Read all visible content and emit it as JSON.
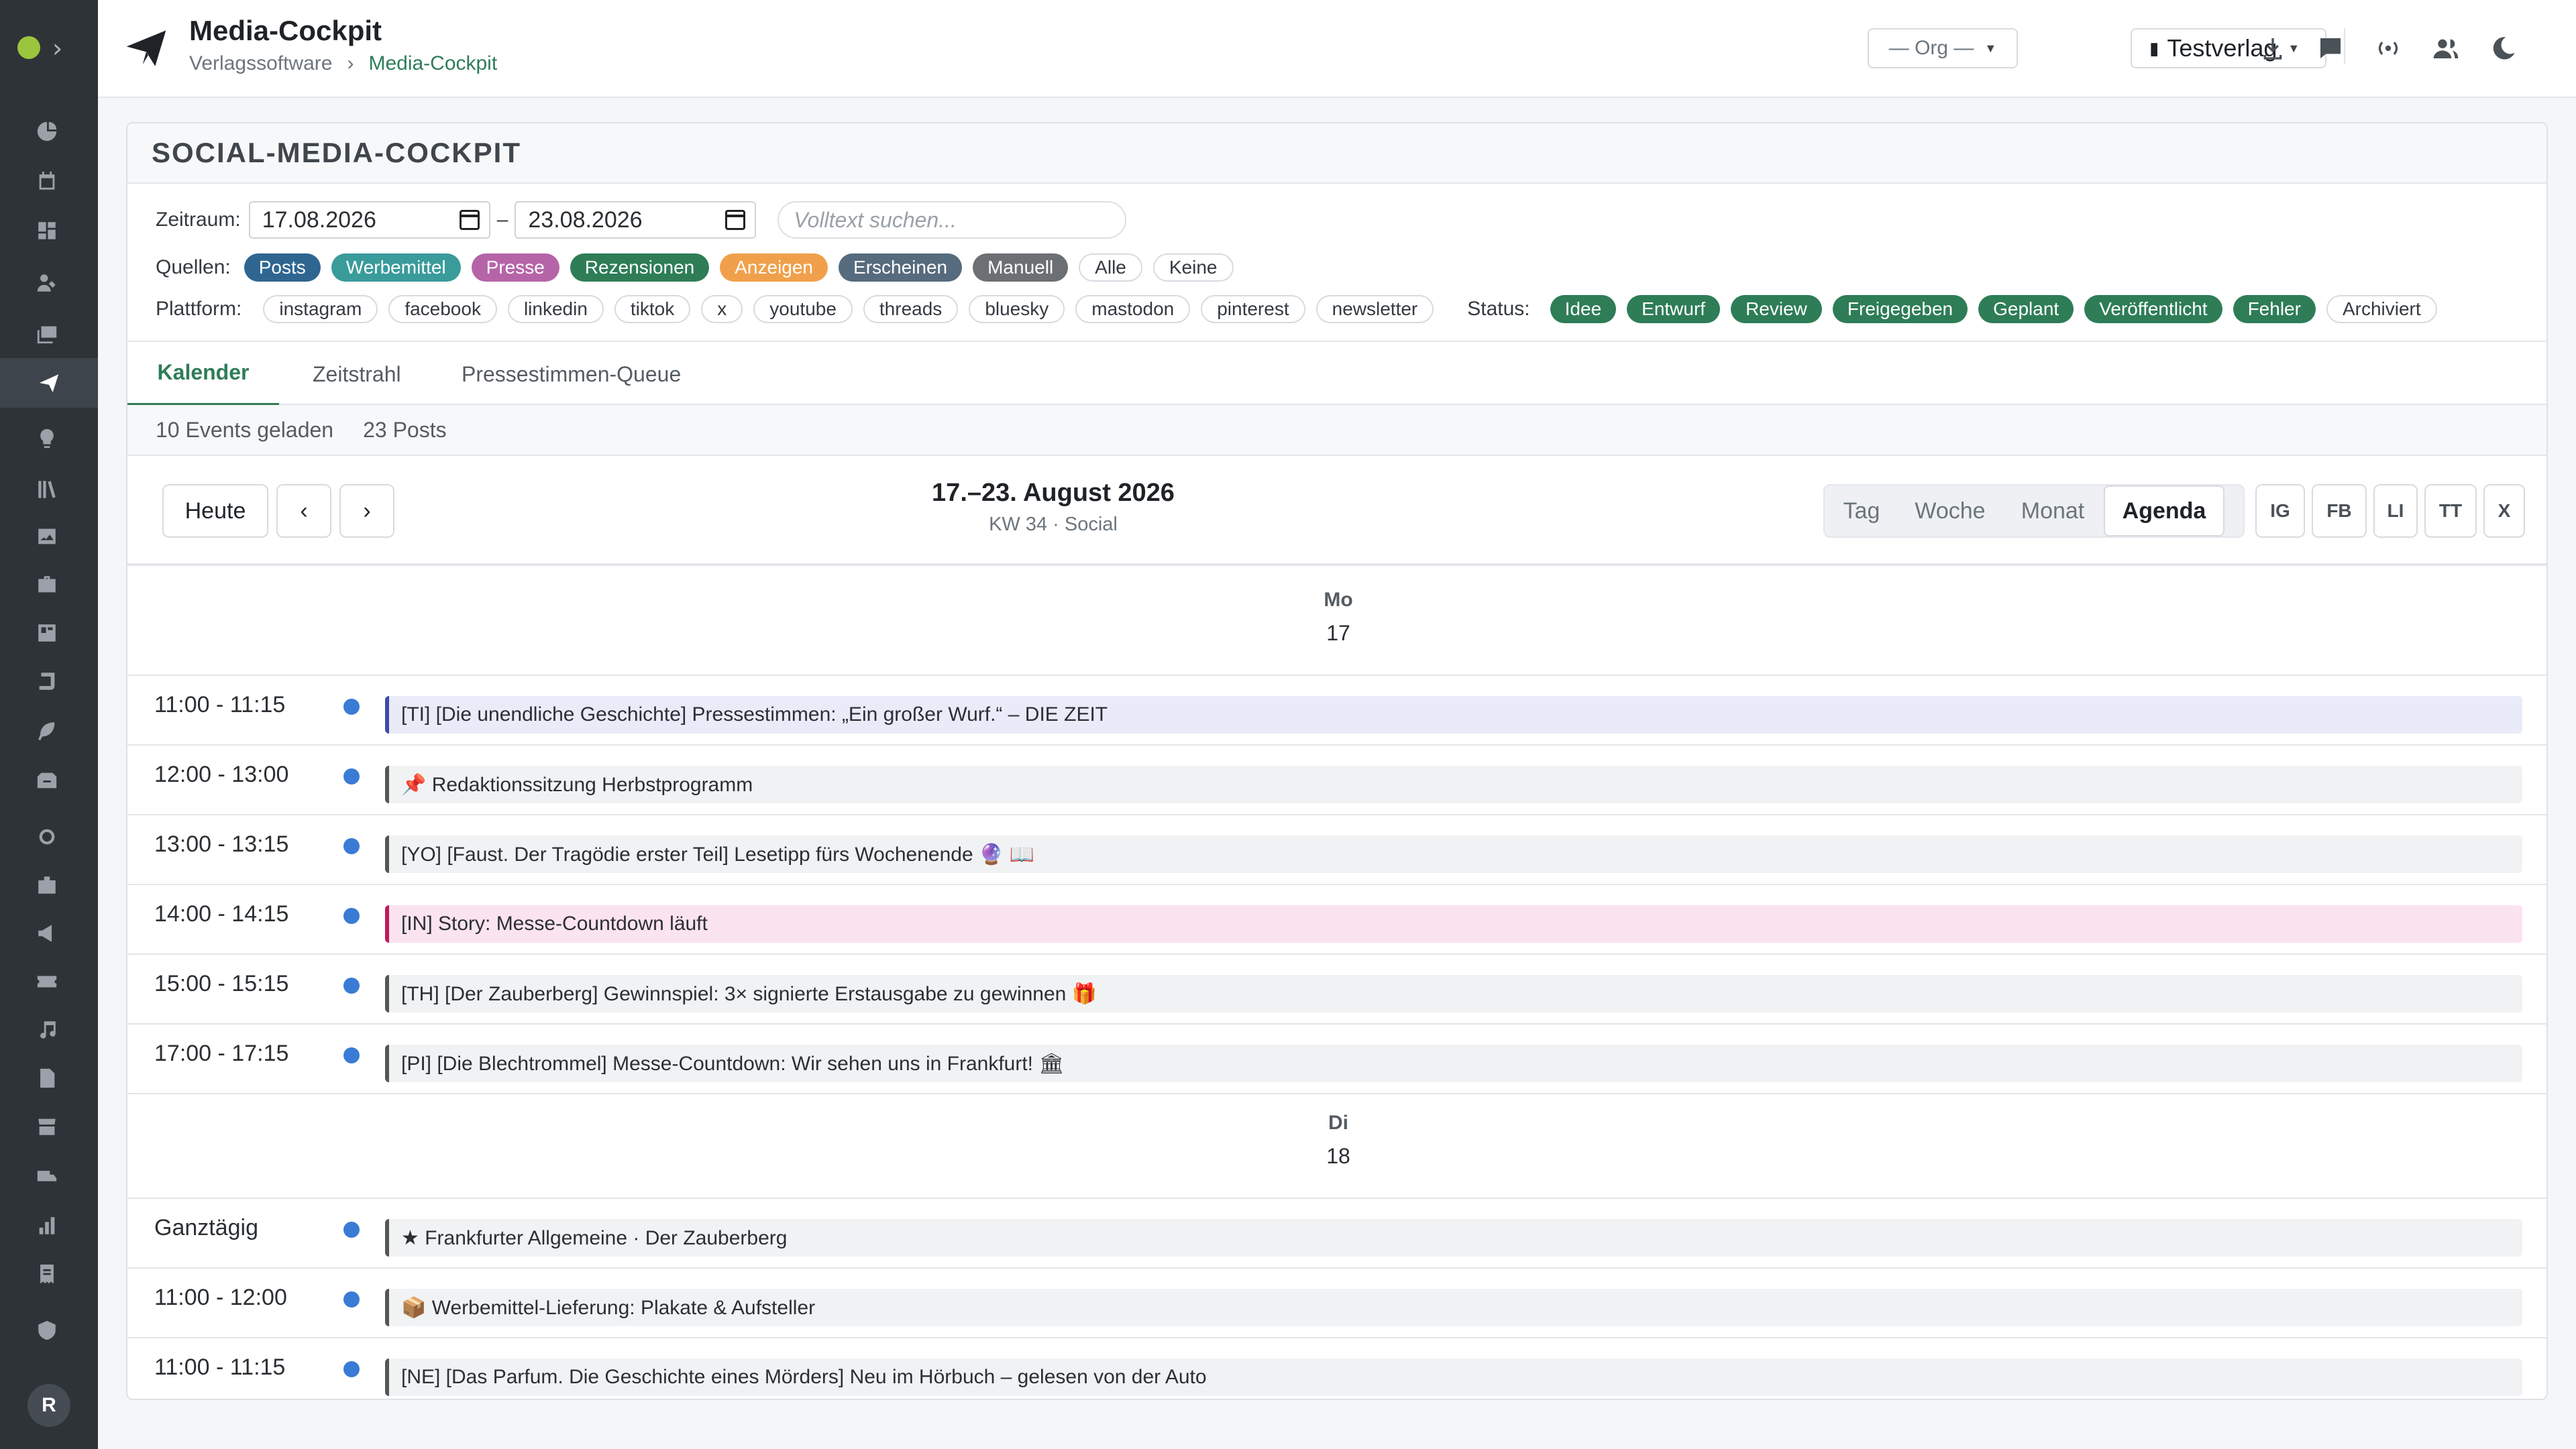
{
  "app": {
    "title": "Media-Cockpit",
    "breadcrumb": [
      "Verlagssoftware",
      "Media-Cockpit"
    ],
    "breadcrumb_sep": "›",
    "avatar": "R"
  },
  "topbar": {
    "org_label": "— Org —",
    "verlag_label": "Testverlag",
    "icons": [
      "download-icon",
      "chat-icon",
      "broadcast-icon",
      "users-icon",
      "moon-icon"
    ]
  },
  "card": {
    "title": "SOCIAL-MEDIA-COCKPIT"
  },
  "filters": {
    "zeitraum_label": "Zeitraum:",
    "date_from": "17.08.2026",
    "date_sep": "–",
    "date_to": "23.08.2026",
    "search_placeholder": "Volltext suchen...",
    "quellen_label": "Quellen:",
    "quellen": [
      {
        "label": "Posts",
        "color": "#2f6690"
      },
      {
        "label": "Werbemittel",
        "color": "#3a9b9b"
      },
      {
        "label": "Presse",
        "color": "#b564a8"
      },
      {
        "label": "Rezensionen",
        "color": "#2e7d57"
      },
      {
        "label": "Anzeigen",
        "color": "#f0a04b"
      },
      {
        "label": "Erscheinen",
        "color": "#566b7d"
      },
      {
        "label": "Manuell",
        "color": "#6c6f73"
      }
    ],
    "quellen_all": "Alle",
    "quellen_none": "Keine",
    "plattform_label": "Plattform:",
    "plattformen": [
      "instagram",
      "facebook",
      "linkedin",
      "tiktok",
      "x",
      "youtube",
      "threads",
      "bluesky",
      "mastodon",
      "pinterest",
      "newsletter"
    ],
    "status_label": "Status:",
    "status": [
      "Idee",
      "Entwurf",
      "Review",
      "Freigegeben",
      "Geplant",
      "Veröffentlicht",
      "Fehler"
    ],
    "status_extra": "Archiviert"
  },
  "tabs": [
    "Kalender",
    "Zeitstrahl",
    "Pressestimmen-Queue"
  ],
  "stats": {
    "events": "10 Events geladen",
    "posts": "23 Posts"
  },
  "calendar": {
    "today": "Heute",
    "prev": "‹",
    "next": "›",
    "title": "17.–23. August 2026",
    "subtitle": "KW 34 · Social",
    "views": [
      "Tag",
      "Woche",
      "Monat",
      "Agenda"
    ],
    "platform_buttons": [
      "IG",
      "FB",
      "LI",
      "TT",
      "X"
    ]
  },
  "days": [
    {
      "weekday": "Mo",
      "day": "17",
      "events": [
        {
          "time": "11:00 - 11:15",
          "text": "[TI] [Die unendliche Geschichte] Pressestimmen: „Ein großer Wurf.“ – DIE ZEIT",
          "bg": "#e9ebf8",
          "border": "#3e4aa8"
        },
        {
          "time": "12:00 - 13:00",
          "text": "📌 Redaktionssitzung Herbstprogramm",
          "bg": "#f1f2f4",
          "border": "#555555"
        },
        {
          "time": "13:00 - 13:15",
          "text": "[YO] [Faust. Der Tragödie erster Teil] Lesetipp fürs Wochenende 🔮 📖",
          "bg": "#f1f2f4",
          "border": "#555555"
        },
        {
          "time": "14:00 - 14:15",
          "text": "[IN] Story: Messe-Countdown läuft",
          "bg": "#fbe3ef",
          "border": "#c2185b"
        },
        {
          "time": "15:00 - 15:15",
          "text": "[TH] [Der Zauberberg] Gewinnspiel: 3× signierte Erstausgabe zu gewinnen 🎁",
          "bg": "#f1f2f4",
          "border": "#555555"
        },
        {
          "time": "17:00 - 17:15",
          "text": "[PI] [Die Blechtrommel] Messe-Countdown: Wir sehen uns in Frankfurt! 🏛",
          "bg": "#f1f2f4",
          "border": "#555555"
        }
      ]
    },
    {
      "weekday": "Di",
      "day": "18",
      "events": [
        {
          "time": "Ganztägig",
          "text": "★ Frankfurter Allgemeine · Der Zauberberg",
          "bg": "#f1f2f4",
          "border": "#555555"
        },
        {
          "time": "11:00 - 12:00",
          "text": "📦 Werbemittel-Lieferung: Plakate & Aufsteller",
          "bg": "#f1f2f4",
          "border": "#555555"
        },
        {
          "time": "11:00 - 11:15",
          "text": "[NE] [Das Parfum. Die Geschichte eines Mörders] Neu im Hörbuch – gelesen von der Auto",
          "bg": "#f1f2f4",
          "border": "#555555"
        }
      ]
    }
  ]
}
